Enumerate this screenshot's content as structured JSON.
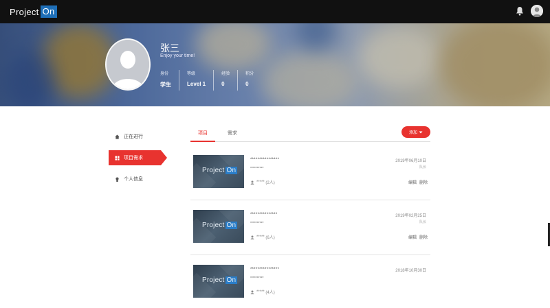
{
  "topbar": {
    "brand_left": "Project",
    "brand_right": "On"
  },
  "profile": {
    "name": "张三",
    "motto": "Enjoy your time!",
    "stats": [
      {
        "label": "身份",
        "value": "学生"
      },
      {
        "label": "等级",
        "value": "Level 1"
      },
      {
        "label": "经验",
        "value": "0"
      },
      {
        "label": "积分",
        "value": "0"
      }
    ]
  },
  "sidebar": {
    "items": [
      {
        "label": "正在进行",
        "icon": "home-icon",
        "active": false
      },
      {
        "label": "项目需求",
        "icon": "grid-icon",
        "active": true
      },
      {
        "label": "个人信息",
        "icon": "user-icon",
        "active": false
      }
    ]
  },
  "tabs": [
    {
      "label": "项目",
      "active": true
    },
    {
      "label": "需求",
      "active": false
    }
  ],
  "add_button": "添加",
  "projects": [
    {
      "title": "****************",
      "subtitle": "**********",
      "members": "*****",
      "count": "(2人)",
      "date": "2019年06月10日",
      "role": "队长",
      "edit": "编辑",
      "delete": "删除"
    },
    {
      "title": "***************",
      "subtitle": "**********",
      "members": "*****",
      "count": "(6人)",
      "date": "2019年02月25日",
      "role": "队长",
      "edit": "编辑",
      "delete": "删除"
    },
    {
      "title": "****************",
      "subtitle": "**********",
      "members": "*****",
      "count": "(4人)",
      "date": "2018年10月30日",
      "role": "",
      "edit": "",
      "delete": ""
    }
  ],
  "thumb_brand": {
    "left": "Project",
    "right": "On"
  },
  "colors": {
    "accent": "#e8332f",
    "navbar": "#111111",
    "brand_blue": "#1e6fb8"
  }
}
